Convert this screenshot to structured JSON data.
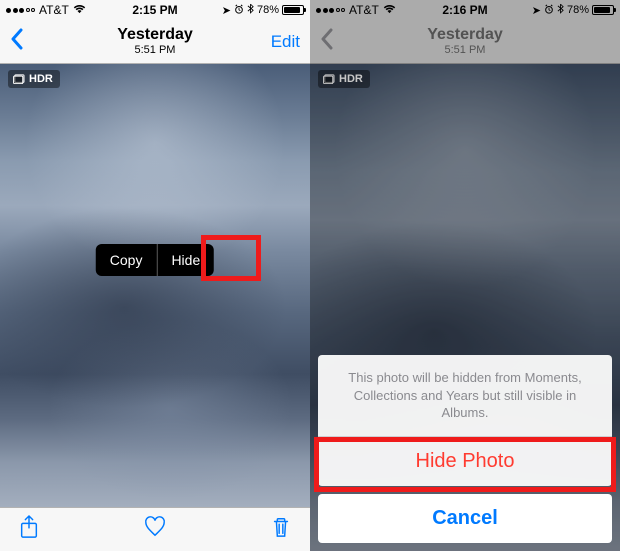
{
  "left": {
    "status": {
      "carrier": "AT&T",
      "time": "2:15 PM",
      "battery": "78%"
    },
    "nav": {
      "title": "Yesterday",
      "subtitle": "5:51 PM",
      "edit": "Edit"
    },
    "hdr": "HDR",
    "context": {
      "copy": "Copy",
      "hide": "Hide"
    }
  },
  "right": {
    "status": {
      "carrier": "AT&T",
      "time": "2:16 PM",
      "battery": "78%"
    },
    "nav": {
      "title": "Yesterday",
      "subtitle": "5:51 PM"
    },
    "hdr": "HDR",
    "sheet": {
      "message": "This photo will be hidden from Moments, Collections and Years but still visible in Albums.",
      "hide": "Hide Photo",
      "cancel": "Cancel"
    }
  }
}
